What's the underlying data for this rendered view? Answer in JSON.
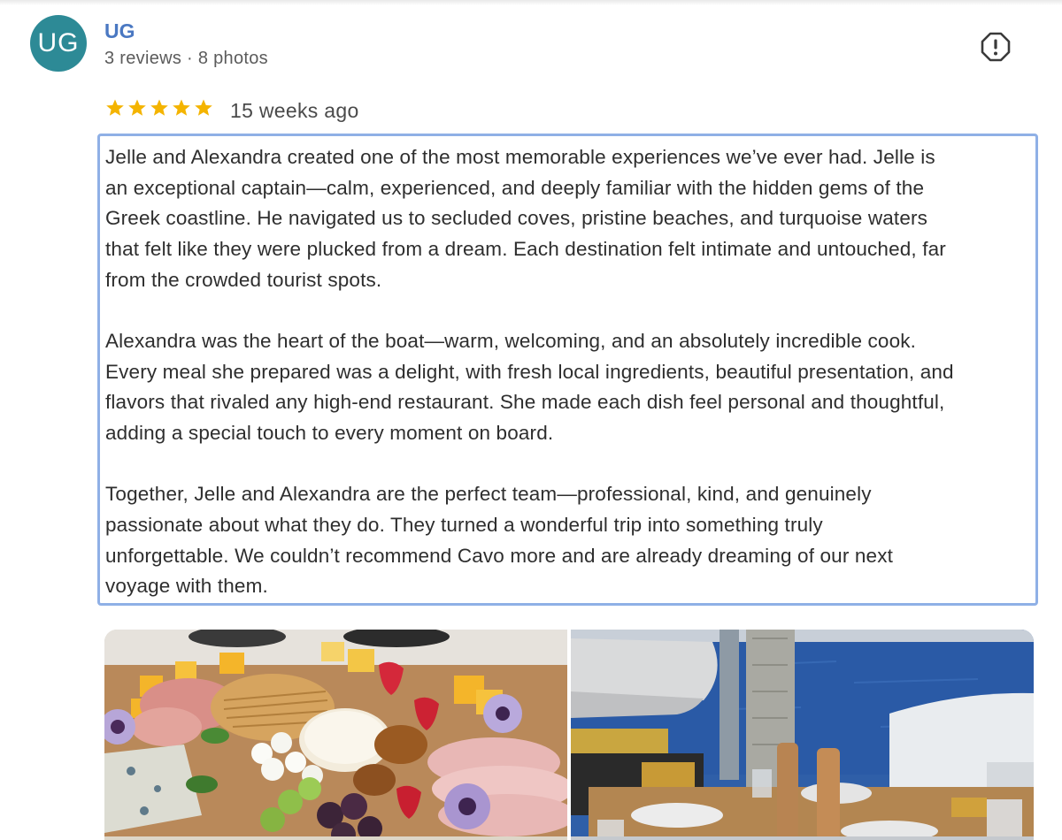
{
  "reviewer": {
    "initials": "UG",
    "name": "UG",
    "meta": "3 reviews · 8 photos",
    "avatar_color": "#2d8a96"
  },
  "review": {
    "rating": 5,
    "rating_max": 5,
    "star_color": "#f4b400",
    "date": "15 weeks ago",
    "paragraphs": [
      "Jelle and Alexandra created one of the most memorable experiences we’ve ever had. Jelle is\nan exceptional captain—calm, experienced, and deeply familiar with the hidden gems of the\nGreek coastline. He navigated us to secluded coves, pristine beaches, and turquoise waters\nthat felt like they were plucked from a dream. Each destination felt intimate and untouched, far\nfrom the crowded tourist spots.",
      "Alexandra was the heart of the boat—warm, welcoming, and an absolutely incredible cook.\nEvery meal she prepared was a delight, with fresh local ingredients, beautiful presentation, and\nflavors that rivaled any high-end restaurant. She made each dish feel personal and thoughtful,\nadding a special touch to every moment on board.",
      "Together, Jelle and Alexandra are the perfect team—professional, kind, and genuinely\npassionate about what they do. They turned a wonderful trip into something truly\nunforgettable. We couldn’t recommend Cavo more and are already dreaming of our next\nvoyage with them."
    ]
  },
  "actions": {
    "report_icon": "report-icon"
  },
  "photos": [
    {
      "icon": "charcuterie-board-photo"
    },
    {
      "icon": "boat-deck-sea-photo"
    }
  ],
  "colors": {
    "name_link": "#4a78c2",
    "selection_border": "#8fb0e6"
  }
}
